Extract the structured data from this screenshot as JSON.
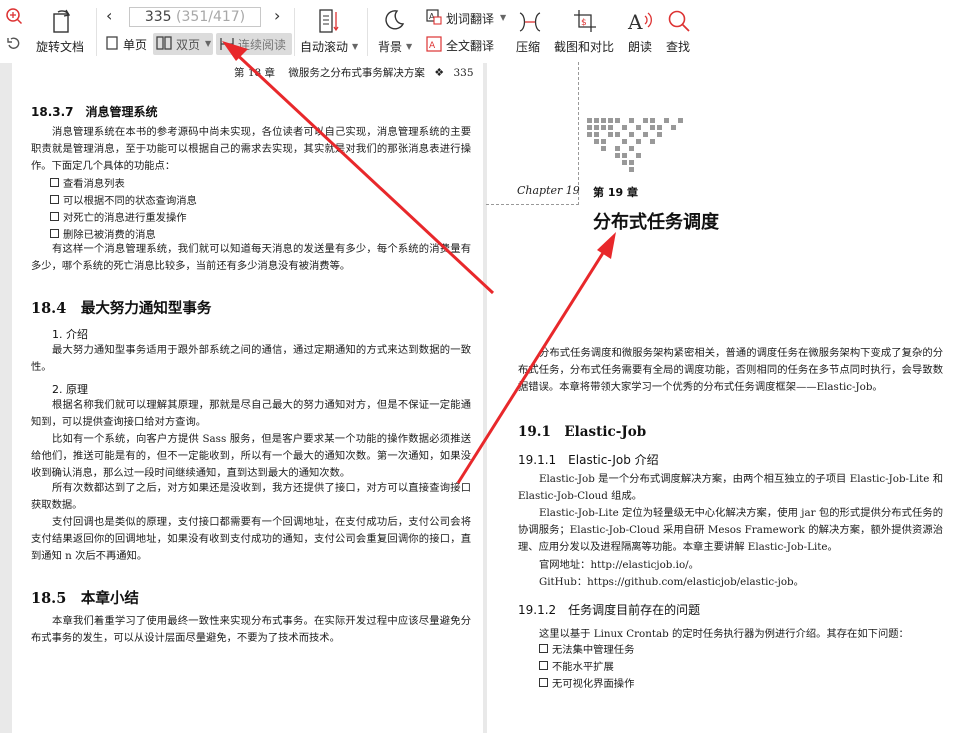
{
  "toolbar": {
    "rotate_label": "旋转文档",
    "single_page": "单页",
    "double_page": "双页",
    "continuous": "连续阅读",
    "auto_scroll": "自动滚动",
    "background": "背景",
    "word_translate": "划词翻译",
    "full_translate": "全文翻译",
    "compress": "压缩",
    "screenshot_compare": "截图和对比",
    "read_aloud": "朗读",
    "find": "查找",
    "page_current": "335",
    "page_total": "(351/417)"
  },
  "left_page": {
    "header_chapter": "第 18 章",
    "header_title": "微服务之分布式事务解决方案",
    "header_page": "335",
    "sec_1837": "18.3.7　消息管理系统",
    "p1": "消息管理系统在本书的参考源码中尚未实现，各位读者可以自己实现，消息管理系统的主要职责就是管理消息，至于功能可以根据自己的需求去实现，其实就是对我们的那张消息表进行操作。下面定几个具体的功能点：",
    "bullets": [
      "查看消息列表",
      "可以根据不同的状态查询消息",
      "对死亡的消息进行重发操作",
      "删除已被消费的消息"
    ],
    "p2": "有这样一个消息管理系统，我们就可以知道每天消息的发送量有多少，每个系统的消费量有多少，哪个系统的死亡消息比较多，当前还有多少消息没有被消费等。",
    "sec_184": "18.4　最大努力通知型事务",
    "sub1": "1. 介绍",
    "p3": "最大努力通知型事务适用于跟外部系统之间的通信，通过定期通知的方式来达到数据的一致性。",
    "sub2": "2. 原理",
    "p4": "根据名称我们就可以理解其原理，那就是尽自己最大的努力通知对方，但是不保证一定能通知到，可以提供查询接口给对方查询。",
    "p5": "比如有一个系统，向客户方提供 Sass 服务，但是客户要求某一个功能的操作数据必须推送给他们，推送可能是有的，但不一定能收到，所以有一个最大的通知次数。第一次通知，如果没收到确认消息，那么过一段时间继续通知，直到达到最大的通知次数。",
    "p6": "所有次数都达到了之后，对方如果还是没收到，我方还提供了接口，对方可以直接查询接口获取数据。",
    "p7": "支付回调也是类似的原理，支付接口都需要有一个回调地址，在支付成功后，支付公司会将支付结果返回你的回调地址，如果没有收到支付成功的通知，支付公司会重复回调你的接口，直到通知 n 次后不再通知。",
    "sec_185": "18.5　本章小结",
    "p8": "本章我们着重学习了使用最终一致性来实现分布式事务。在实际开发过程中应该尽量避免分布式事务的发生，可以从设计层面尽量避免，不要为了技术而技术。"
  },
  "right_page": {
    "chapter_script": "Chapter 19",
    "chapter_num": "第 19 章",
    "chapter_title": "分布式任务调度",
    "intro": "分布式任务调度和微服务架构紧密相关，普通的调度任务在微服务架构下变成了复杂的分布式任务，分布式任务需要有全局的调度功能，否则相同的任务在多节点同时执行，会导致数据错误。本章将带领大家学习一个优秀的分布式任务调度框架——Elastic-Job。",
    "sec_191": "19.1　Elastic-Job",
    "sec_1911": "19.1.1　Elastic-Job 介绍",
    "p1": "Elastic-Job 是一个分布式调度解决方案，由两个相互独立的子项目 Elastic-Job-Lite 和 Elastic-Job-Cloud 组成。",
    "p2": "Elastic-Job-Lite 定位为轻量级无中心化解决方案，使用 jar 包的形式提供分布式任务的协调服务；Elastic-Job-Cloud 采用自研 Mesos Framework 的解决方案，额外提供资源治理、应用分发以及进程隔离等功能。本章主要讲解 Elastic-Job-Lite。",
    "site": "官网地址：http://elasticjob.io/。",
    "github": "GitHub：https://github.com/elasticjob/elastic-job。",
    "sec_1912": "19.1.2　任务调度目前存在的问题",
    "p3": "这里以基于 Linux Crontab 的定时任务执行器为例进行介绍。其存在如下问题：",
    "bullets": [
      "无法集中管理任务",
      "不能水平扩展",
      "无可视化界面操作"
    ]
  },
  "colors": {
    "annotation_red": "#e8282b",
    "toolbar_bg": "#ffffff",
    "viewer_bg": "#e9e9e9"
  }
}
